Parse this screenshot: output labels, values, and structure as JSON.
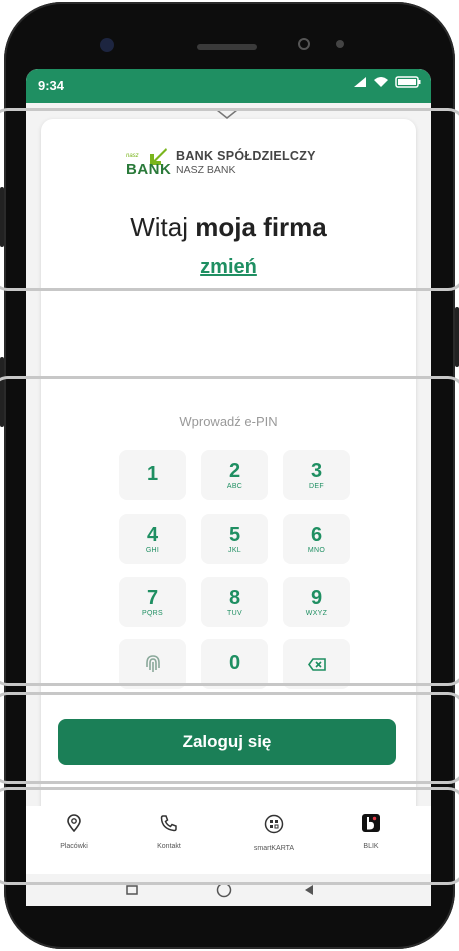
{
  "status_bar": {
    "time": "9:34"
  },
  "bank": {
    "logo_small": "nasz",
    "logo_big": "BANK",
    "name_line1": "BANK SPÓŁDZIELCZY",
    "name_line2": "NASZ BANK"
  },
  "greeting": {
    "prefix": "Witaj",
    "name": "moja firma"
  },
  "change_link": "zmień",
  "pin_placeholder": "Wprowadź e-PIN",
  "keypad": [
    {
      "digit": "1",
      "letters": ""
    },
    {
      "digit": "2",
      "letters": "ABC"
    },
    {
      "digit": "3",
      "letters": "DEF"
    },
    {
      "digit": "4",
      "letters": "GHI"
    },
    {
      "digit": "5",
      "letters": "JKL"
    },
    {
      "digit": "6",
      "letters": "MNO"
    },
    {
      "digit": "7",
      "letters": "PQRS"
    },
    {
      "digit": "8",
      "letters": "TUV"
    },
    {
      "digit": "9",
      "letters": "WXYZ"
    },
    {
      "digit": "0",
      "letters": ""
    }
  ],
  "login_button": "Zaloguj się",
  "bottom_nav": [
    {
      "label": "Placówki",
      "icon": "location-pin-icon"
    },
    {
      "label": "Kontakt",
      "icon": "phone-icon"
    },
    {
      "label": "smartKARTA",
      "icon": "smartcard-icon"
    },
    {
      "label": "BLIK",
      "icon": "blik-icon"
    }
  ],
  "colors": {
    "accent": "#1f8f62",
    "button": "#1b7f57",
    "logo_green": "#7ab51d"
  }
}
